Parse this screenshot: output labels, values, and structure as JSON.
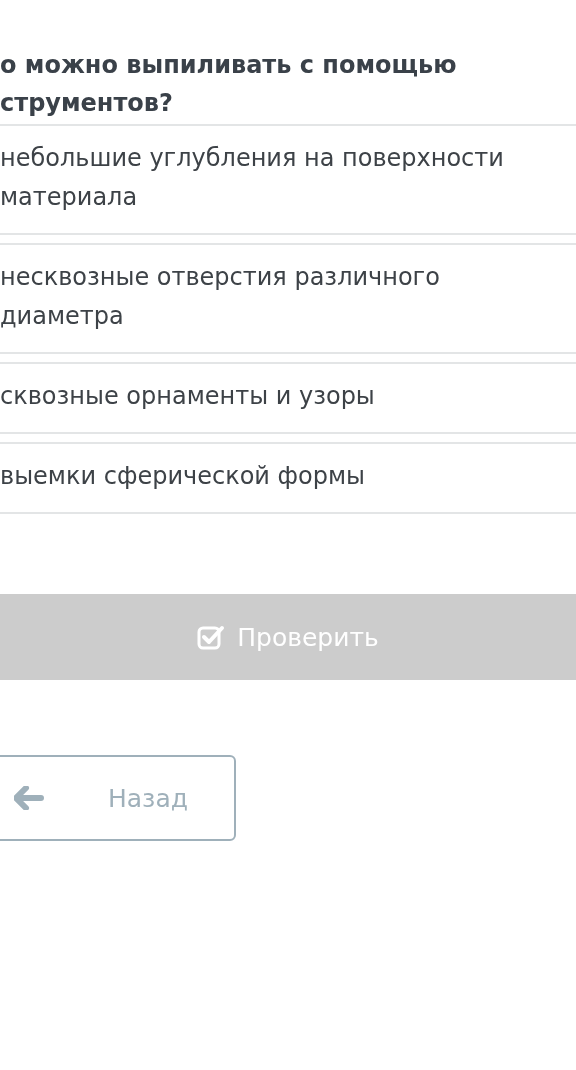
{
  "question": {
    "lines": [
      "о можно выпиливать с помощью",
      "струментов?"
    ]
  },
  "options": [
    {
      "label": "небольшие углубления на поверхности материала"
    },
    {
      "label": "несквозные отверстия различного диаметра"
    },
    {
      "label": "сквозные орнаменты и узоры"
    },
    {
      "label": "выемки сферической формы"
    }
  ],
  "check_button": {
    "label": "Проверить",
    "disabled": true
  },
  "back_button": {
    "label": "Назад"
  }
}
